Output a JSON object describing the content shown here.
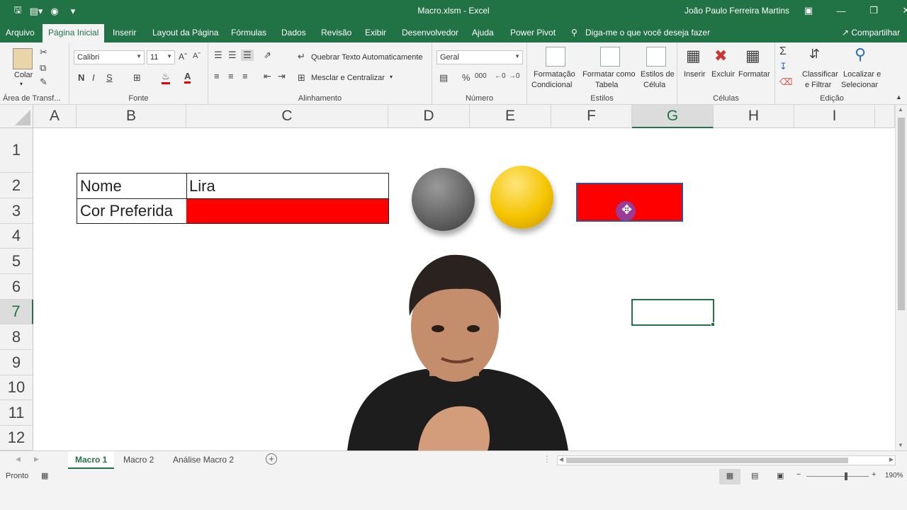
{
  "window": {
    "title": "Macro.xlsm  -  Excel",
    "user": "João Paulo Ferreira Martins"
  },
  "tabs": {
    "arquivo": "Arquivo",
    "pagina_inicial": "Página Inicial",
    "inserir": "Inserir",
    "layout": "Layout da Página",
    "formulas": "Fórmulas",
    "dados": "Dados",
    "revisao": "Revisão",
    "exibir": "Exibir",
    "desenvolvedor": "Desenvolvedor",
    "ajuda": "Ajuda",
    "power_pivot": "Power Pivot",
    "tell_me": "Diga-me o que você deseja fazer",
    "share": "Compartilhar"
  },
  "ribbon": {
    "clipboard": {
      "paste": "Colar",
      "group": "Área de Transf..."
    },
    "font": {
      "name": "Calibri",
      "size": "11",
      "bold": "N",
      "italic": "I",
      "underline": "S",
      "group": "Fonte"
    },
    "alignment": {
      "wrap": "Quebrar Texto Automaticamente",
      "merge": "Mesclar e Centralizar",
      "group": "Alinhamento"
    },
    "number": {
      "format": "Geral",
      "percent": "%",
      "thousands": "000",
      "group": "Número"
    },
    "styles": {
      "conditional_l1": "Formatação",
      "conditional_l2": "Condicional",
      "table_l1": "Formatar como",
      "table_l2": "Tabela",
      "cell_l1": "Estilos de",
      "cell_l2": "Célula",
      "group": "Estilos"
    },
    "cells": {
      "insert": "Inserir",
      "delete": "Excluir",
      "format": "Formatar",
      "group": "Células"
    },
    "editing": {
      "sort_l1": "Classificar",
      "sort_l2": "e Filtrar",
      "find_l1": "Localizar e",
      "find_l2": "Selecionar",
      "group": "Edição"
    }
  },
  "grid": {
    "columns": [
      "A",
      "B",
      "C",
      "D",
      "E",
      "F",
      "G",
      "H",
      "I"
    ],
    "rows": [
      "1",
      "2",
      "3",
      "4",
      "5",
      "6",
      "7",
      "8",
      "9",
      "10",
      "11",
      "12"
    ],
    "selected_column": "G",
    "selected_row": "7",
    "cells": {
      "b2": "Nome",
      "c2": "Lira",
      "b3": "Cor Preferida"
    },
    "colors": {
      "favorite": "#ff0000",
      "gray_button": "#666666",
      "yellow_button": "#f5c400"
    }
  },
  "sheets": [
    "Macro 1",
    "Macro 2",
    "Análise Macro 2"
  ],
  "status": {
    "ready": "Pronto",
    "zoom": "190%"
  }
}
